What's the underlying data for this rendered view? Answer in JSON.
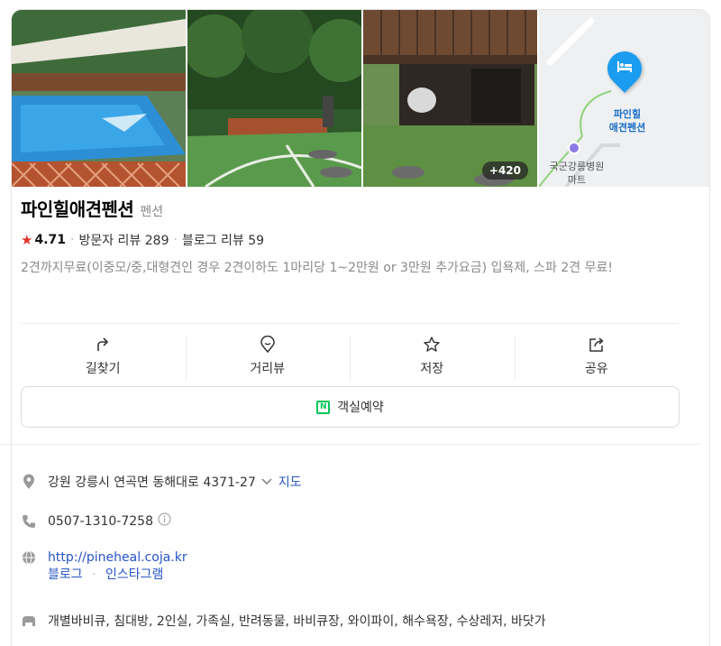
{
  "gallery": {
    "more_count": "+420"
  },
  "map": {
    "pin_label": "파인힐\n애견펜션",
    "poi_label": "국군강릉병원\n마트"
  },
  "place": {
    "name": "파인힐애견펜션",
    "category": "펜션",
    "rating": "4.71",
    "visitor_reviews": "방문자 리뷰 289",
    "blog_reviews": "블로그 리뷰 59",
    "description": "2견까지무료(이중모/중,대형견인 경우 2견이하도 1마리당 1~2만원 or 3만원 추가요금) 입욕제, 스파 2견 무료!"
  },
  "actions": [
    {
      "label": "길찾기",
      "icon": "directions-icon"
    },
    {
      "label": "거리뷰",
      "icon": "location-pin-icon"
    },
    {
      "label": "저장",
      "icon": "star-outline-icon"
    },
    {
      "label": "공유",
      "icon": "share-icon"
    }
  ],
  "reserve": {
    "label": "객실예약"
  },
  "info": {
    "address": "강원 강릉시 연곡면 동해대로 4371-27",
    "map_link": "지도",
    "phone": "0507-1310-7258",
    "website": "http://pineheal.coja.kr",
    "blog": "블로그",
    "instagram": "인스타그램",
    "amenities": "개별바비큐, 침대방, 2인실, 가족실, 반려동물, 바비큐장, 와이파이, 해수욕장, 수상레저, 바닷가"
  },
  "colors": {
    "accent_blue": "#2754c5",
    "naver_green": "#03c75a",
    "star_red": "#e4322e"
  }
}
